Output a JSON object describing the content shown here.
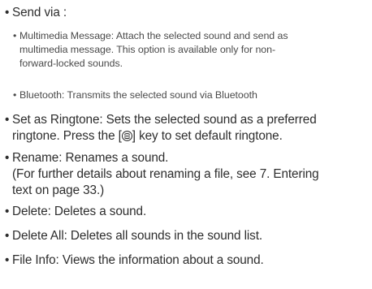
{
  "bullet": "•",
  "send_via": {
    "label": "Send via :",
    "options": [
      {
        "line1": "Multimedia Message: Attach the selected sound and send as",
        "line2": "multimedia message. This option is available only for non-",
        "line3": "forward-locked sounds."
      },
      {
        "line1": "Bluetooth: Transmits the selected sound via Bluetooth"
      }
    ]
  },
  "set_as_ringtone": {
    "line1": "Set as Ringtone: Sets the selected sound as a preferred",
    "line2_before_key": "ringtone. Press the [",
    "line2_after_key": "] key to set default ringtone.",
    "key_icon": "menu-softkey-icon"
  },
  "rename": {
    "line1": "Rename: Renames a sound.",
    "line2": "(For further details about renaming a file, see 7. Entering",
    "line3": "text on page 33.)"
  },
  "delete": {
    "line1": "Delete: Deletes a sound."
  },
  "delete_all": {
    "line1": "Delete All: Deletes all sounds in the sound list."
  },
  "file_info": {
    "line1": "File Info: Views the information about a sound."
  }
}
